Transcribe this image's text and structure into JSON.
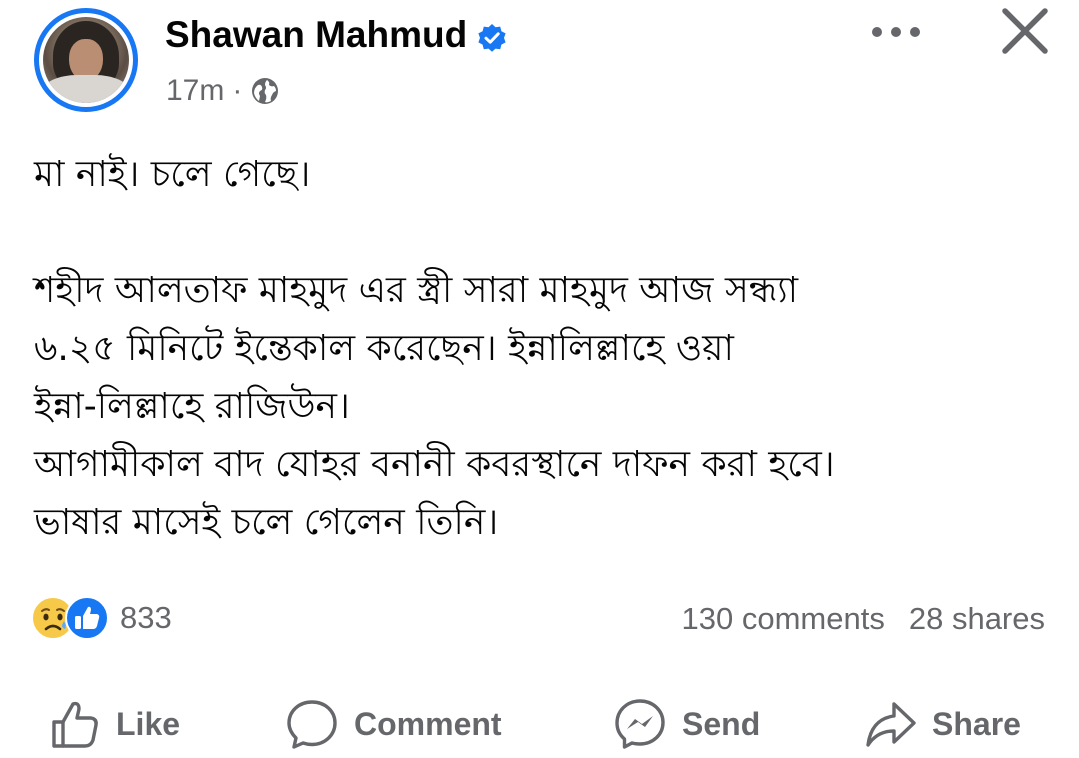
{
  "post": {
    "author": "Shawan Mahmud",
    "verified": true,
    "time": "17m",
    "separator": "·",
    "audience_icon": "globe-icon",
    "body": {
      "line1": "মা নাই। চলে গেছে।",
      "line2": "শহীদ আলতাফ মাহমুদ এর স্ত্রী সারা মাহমুদ আজ সন্ধ্যা",
      "line3": "৬.২৫ মিনিটে ইন্তেকাল করেছেন। ইন্নালিল্লাহে ওয়া",
      "line4": "ইন্না-লিল্লাহে রাজিউন।",
      "line5": "আগামীকাল বাদ যোহর বনানী কবরস্থানে দাফন করা হবে।",
      "line6": "ভাষার মাসেই চলে গেলেন তিনি।"
    }
  },
  "stats": {
    "reaction_icons": [
      "sad-icon",
      "like-icon"
    ],
    "reaction_count": "833",
    "comments": "130 comments",
    "shares": "28 shares"
  },
  "actions": {
    "like": "Like",
    "comment": "Comment",
    "send": "Send",
    "share": "Share"
  },
  "colors": {
    "accent": "#1877f2",
    "secondary_text": "#65676b",
    "primary_text": "#050505"
  }
}
